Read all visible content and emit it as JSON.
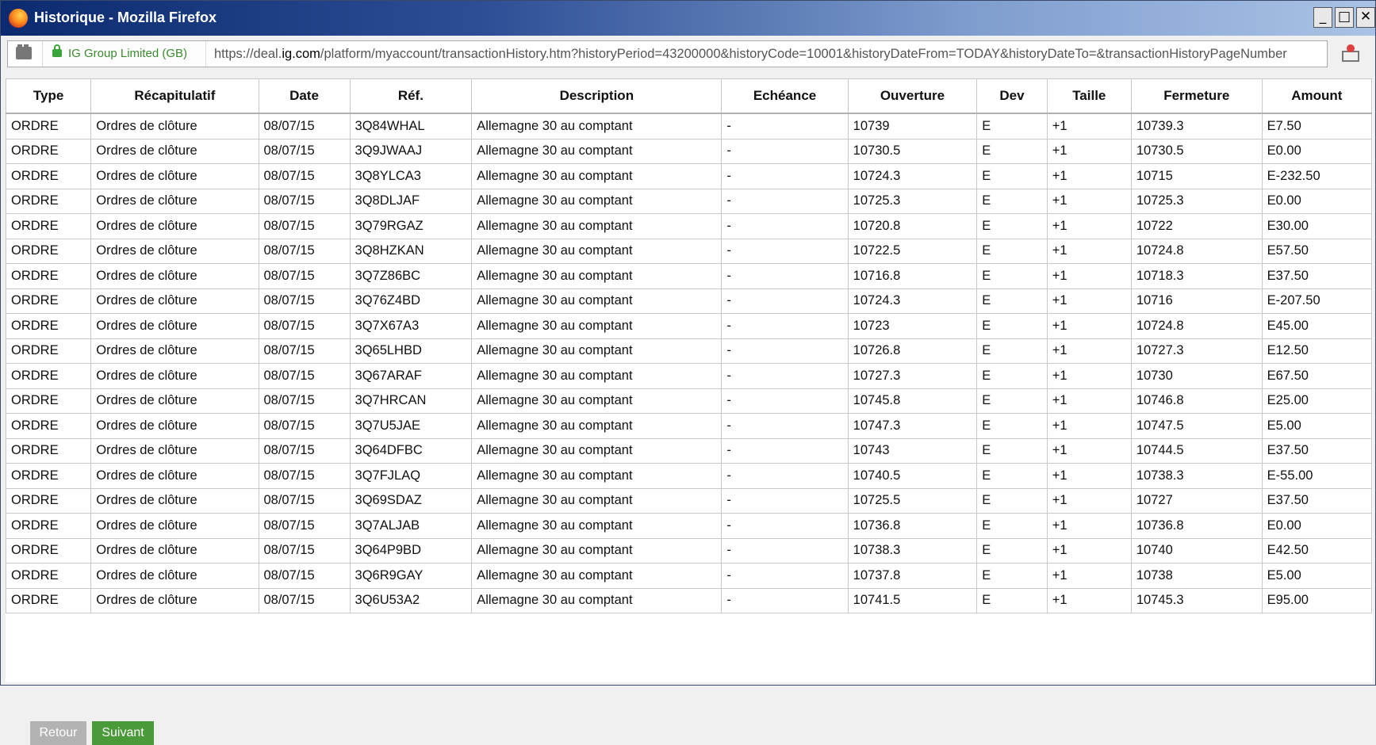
{
  "window": {
    "title": "Historique - Mozilla Firefox",
    "buttons": {
      "minimize": "_",
      "maximize": "□",
      "close": "✕"
    }
  },
  "urlbar": {
    "site_identity": "IG Group Limited (GB)",
    "url_prefix": "https://deal.",
    "url_domain": "ig.com",
    "url_rest": "/platform/myaccount/transactionHistory.htm?historyPeriod=43200000&historyCode=10001&historyDateFrom=TODAY&historyDateTo=&transactionHistoryPageNumber"
  },
  "table": {
    "columns": [
      "Type",
      "Récapitulatif",
      "Date",
      "Réf.",
      "Description",
      "Echéance",
      "Ouverture",
      "Dev",
      "Taille",
      "Fermeture",
      "Amount"
    ],
    "rows": [
      [
        "ORDRE",
        "Ordres de clôture",
        "08/07/15",
        "3Q84WHAL",
        "Allemagne 30 au comptant",
        "-",
        "10739",
        "E",
        "+1",
        "10739.3",
        "E7.50"
      ],
      [
        "ORDRE",
        "Ordres de clôture",
        "08/07/15",
        "3Q9JWAAJ",
        "Allemagne 30 au comptant",
        "-",
        "10730.5",
        "E",
        "+1",
        "10730.5",
        "E0.00"
      ],
      [
        "ORDRE",
        "Ordres de clôture",
        "08/07/15",
        "3Q8YLCA3",
        "Allemagne 30 au comptant",
        "-",
        "10724.3",
        "E",
        "+1",
        "10715",
        "E-232.50"
      ],
      [
        "ORDRE",
        "Ordres de clôture",
        "08/07/15",
        "3Q8DLJAF",
        "Allemagne 30 au comptant",
        "-",
        "10725.3",
        "E",
        "+1",
        "10725.3",
        "E0.00"
      ],
      [
        "ORDRE",
        "Ordres de clôture",
        "08/07/15",
        "3Q79RGAZ",
        "Allemagne 30 au comptant",
        "-",
        "10720.8",
        "E",
        "+1",
        "10722",
        "E30.00"
      ],
      [
        "ORDRE",
        "Ordres de clôture",
        "08/07/15",
        "3Q8HZKAN",
        "Allemagne 30 au comptant",
        "-",
        "10722.5",
        "E",
        "+1",
        "10724.8",
        "E57.50"
      ],
      [
        "ORDRE",
        "Ordres de clôture",
        "08/07/15",
        "3Q7Z86BC",
        "Allemagne 30 au comptant",
        "-",
        "10716.8",
        "E",
        "+1",
        "10718.3",
        "E37.50"
      ],
      [
        "ORDRE",
        "Ordres de clôture",
        "08/07/15",
        "3Q76Z4BD",
        "Allemagne 30 au comptant",
        "-",
        "10724.3",
        "E",
        "+1",
        "10716",
        "E-207.50"
      ],
      [
        "ORDRE",
        "Ordres de clôture",
        "08/07/15",
        "3Q7X67A3",
        "Allemagne 30 au comptant",
        "-",
        "10723",
        "E",
        "+1",
        "10724.8",
        "E45.00"
      ],
      [
        "ORDRE",
        "Ordres de clôture",
        "08/07/15",
        "3Q65LHBD",
        "Allemagne 30 au comptant",
        "-",
        "10726.8",
        "E",
        "+1",
        "10727.3",
        "E12.50"
      ],
      [
        "ORDRE",
        "Ordres de clôture",
        "08/07/15",
        "3Q67ARAF",
        "Allemagne 30 au comptant",
        "-",
        "10727.3",
        "E",
        "+1",
        "10730",
        "E67.50"
      ],
      [
        "ORDRE",
        "Ordres de clôture",
        "08/07/15",
        "3Q7HRCAN",
        "Allemagne 30 au comptant",
        "-",
        "10745.8",
        "E",
        "+1",
        "10746.8",
        "E25.00"
      ],
      [
        "ORDRE",
        "Ordres de clôture",
        "08/07/15",
        "3Q7U5JAE",
        "Allemagne 30 au comptant",
        "-",
        "10747.3",
        "E",
        "+1",
        "10747.5",
        "E5.00"
      ],
      [
        "ORDRE",
        "Ordres de clôture",
        "08/07/15",
        "3Q64DFBC",
        "Allemagne 30 au comptant",
        "-",
        "10743",
        "E",
        "+1",
        "10744.5",
        "E37.50"
      ],
      [
        "ORDRE",
        "Ordres de clôture",
        "08/07/15",
        "3Q7FJLAQ",
        "Allemagne 30 au comptant",
        "-",
        "10740.5",
        "E",
        "+1",
        "10738.3",
        "E-55.00"
      ],
      [
        "ORDRE",
        "Ordres de clôture",
        "08/07/15",
        "3Q69SDAZ",
        "Allemagne 30 au comptant",
        "-",
        "10725.5",
        "E",
        "+1",
        "10727",
        "E37.50"
      ],
      [
        "ORDRE",
        "Ordres de clôture",
        "08/07/15",
        "3Q7ALJAB",
        "Allemagne 30 au comptant",
        "-",
        "10736.8",
        "E",
        "+1",
        "10736.8",
        "E0.00"
      ],
      [
        "ORDRE",
        "Ordres de clôture",
        "08/07/15",
        "3Q64P9BD",
        "Allemagne 30 au comptant",
        "-",
        "10738.3",
        "E",
        "+1",
        "10740",
        "E42.50"
      ],
      [
        "ORDRE",
        "Ordres de clôture",
        "08/07/15",
        "3Q6R9GAY",
        "Allemagne 30 au comptant",
        "-",
        "10737.8",
        "E",
        "+1",
        "10738",
        "E5.00"
      ],
      [
        "ORDRE",
        "Ordres de clôture",
        "08/07/15",
        "3Q6U53A2",
        "Allemagne 30 au comptant",
        "-",
        "10741.5",
        "E",
        "+1",
        "10745.3",
        "E95.00"
      ]
    ]
  },
  "pagination": {
    "back_label": "Retour",
    "next_label": "Suivant"
  },
  "colors": {
    "next_button": "#4b9a3a",
    "back_button": "#b3b3b3",
    "site_identity": "#3a8a2e"
  }
}
